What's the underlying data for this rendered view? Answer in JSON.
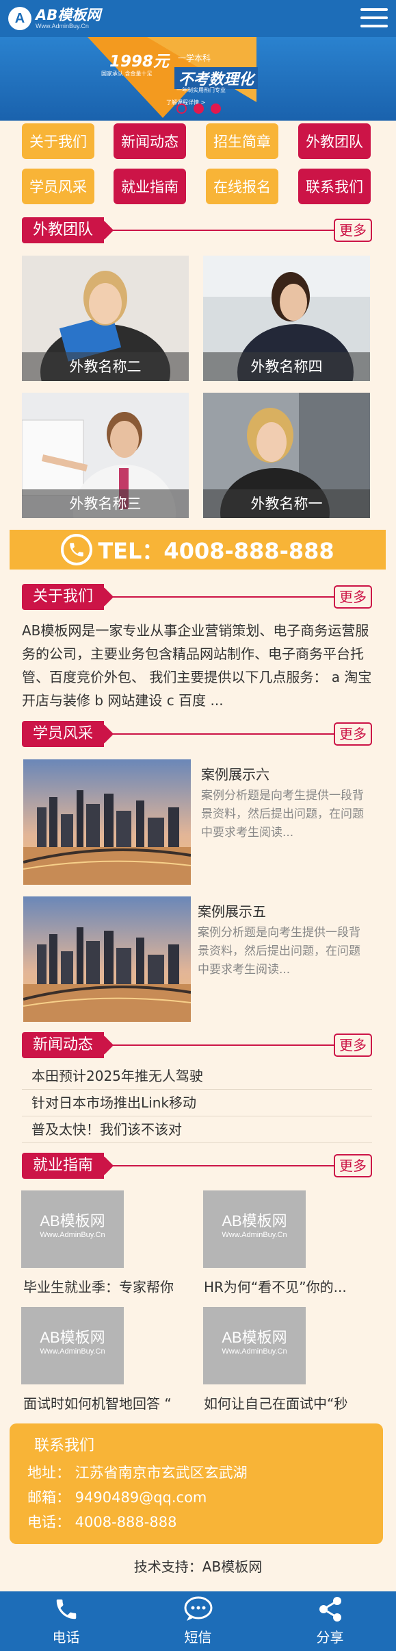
{
  "header": {
    "logo_badge": "A",
    "logo_title": "AB模板网",
    "logo_sub": "Www.AdminBuy.Cn"
  },
  "banner": {
    "price": "1998元",
    "price_sub": "一学本科",
    "small": "国家承认 含金量十足",
    "big": "不考数理化",
    "line2": "一年制实用热门专业",
    "link": "了解课程详情 >"
  },
  "nav": [
    {
      "label": "关于我们"
    },
    {
      "label": "新闻动态"
    },
    {
      "label": "招生简章"
    },
    {
      "label": "外教团队"
    },
    {
      "label": "学员风采"
    },
    {
      "label": "就业指南"
    },
    {
      "label": "在线报名"
    },
    {
      "label": "联系我们"
    }
  ],
  "more_label": "更多",
  "sections": {
    "teachers": "外教团队",
    "about": "关于我们",
    "cases": "学员风采",
    "news": "新闻动态",
    "guide": "就业指南"
  },
  "teachers": [
    {
      "name": "外教名称二"
    },
    {
      "name": "外教名称四"
    },
    {
      "name": "外教名称三"
    },
    {
      "name": "外教名称一"
    }
  ],
  "phone": "TEL：4008-888-888",
  "about_text": "AB模板网是一家专业从事企业营销策划、电子商务运营服务的公司，主要业务包含精品网站制作、电子商务平台托管、百度竞价外包、 我们主要提供以下几点服务： a 淘宝开店与装修 b 网站建设 c 百度 ...",
  "cases": [
    {
      "title": "案例展示六",
      "desc": "案例分析题是向考生提供一段背景资料，然后提出问题，在问题中要求考生阅读..."
    },
    {
      "title": "案例展示五",
      "desc": "案例分析题是向考生提供一段背景资料，然后提出问题，在问题中要求考生阅读..."
    }
  ],
  "news": [
    "本田预计2025年推无人驾驶",
    "针对日本市场推出Link移动",
    "普及太快！我们该不该对"
  ],
  "placeholder": {
    "t1": "AB模板网",
    "t2": "Www.AdminBuy.Cn"
  },
  "guides": [
    {
      "title": "毕业生就业季：专家帮你"
    },
    {
      "title": "HR为何“看不见”你的..."
    },
    {
      "title": "面试时如何机智地回答 “"
    },
    {
      "title": "如何让自己在面试中“秒"
    }
  ],
  "contact": {
    "title": "联系我们",
    "address": "地址：  江苏省南京市玄武区玄武湖",
    "email": "邮箱：  9490489@qq.com",
    "phone": "电话：  4008-888-888"
  },
  "support": "技术支持：AB模板网",
  "footer": [
    {
      "label": "电话",
      "icon": "phone-icon"
    },
    {
      "label": "短信",
      "icon": "sms-icon"
    },
    {
      "label": "分享",
      "icon": "share-icon"
    }
  ],
  "colors": {
    "primary": "#1d6db8",
    "accent_red": "#cc1447",
    "accent_orange": "#f8b437",
    "page_bg": "#fdf3e6"
  }
}
